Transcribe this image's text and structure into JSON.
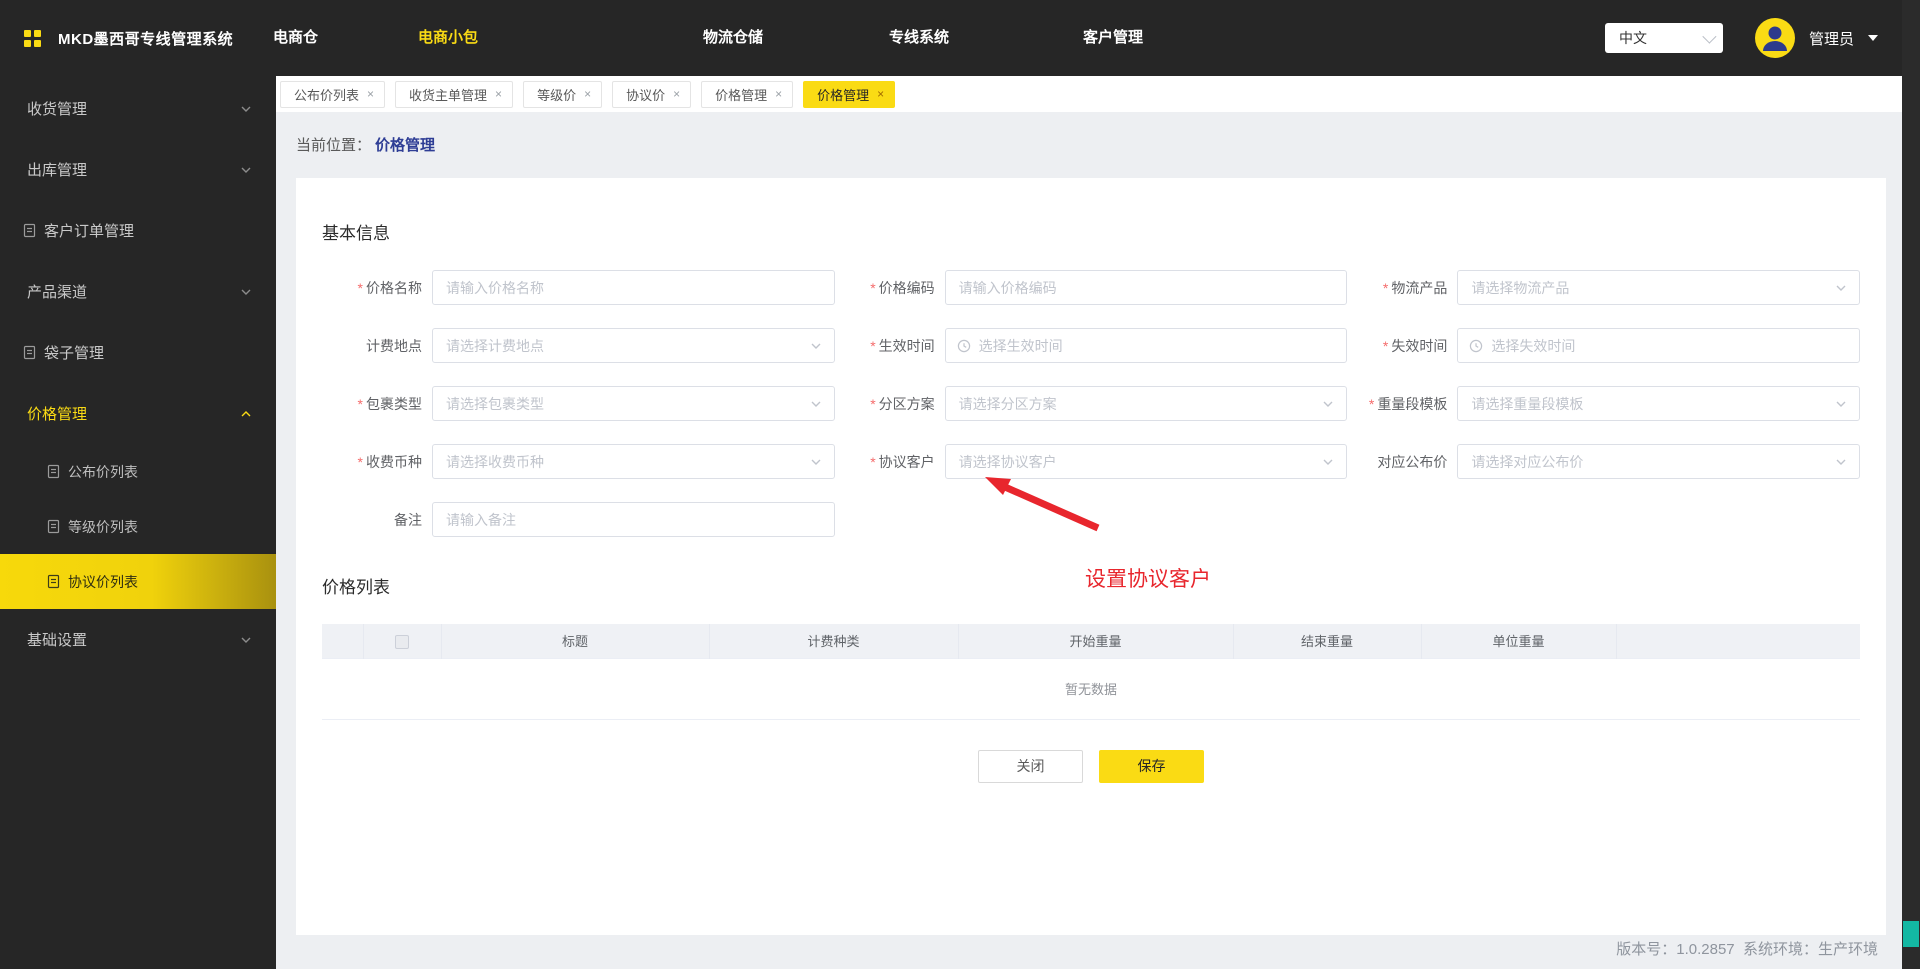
{
  "header": {
    "title": "MKD墨西哥专线管理系统",
    "nav": [
      {
        "label": "电商仓",
        "name": "nav-item-ecommerce-warehouse",
        "active": false
      },
      {
        "label": "电商小包",
        "name": "nav-item-ecommerce-parcel",
        "active": true
      },
      {
        "label": "物流仓储",
        "name": "nav-item-logistics-storage",
        "active": false
      },
      {
        "label": "专线系统",
        "name": "nav-item-dedicated-line",
        "active": false
      },
      {
        "label": "客户管理",
        "name": "nav-item-customer-management",
        "active": false
      }
    ],
    "language": "中文",
    "user": "管理员"
  },
  "sidebar": {
    "items": [
      {
        "label": "收货管理",
        "name": "sidebar-item-receiving",
        "type": "group",
        "chevron": "down"
      },
      {
        "label": "出库管理",
        "name": "sidebar-item-outbound",
        "type": "group",
        "chevron": "down"
      },
      {
        "label": "客户订单管理",
        "name": "sidebar-item-customer-orders",
        "type": "doc"
      },
      {
        "label": "产品渠道",
        "name": "sidebar-item-product-channel",
        "type": "group",
        "chevron": "down"
      },
      {
        "label": "袋子管理",
        "name": "sidebar-item-bag-management",
        "type": "doc"
      },
      {
        "label": "价格管理",
        "name": "sidebar-item-price-management",
        "type": "group",
        "chevron": "up",
        "open": true
      },
      {
        "label": "公布价列表",
        "name": "sidebar-item-published-price-list",
        "type": "sub"
      },
      {
        "label": "等级价列表",
        "name": "sidebar-item-level-price-list",
        "type": "sub"
      },
      {
        "label": "协议价列表",
        "name": "sidebar-item-agreement-price-list",
        "type": "sub",
        "active": true
      },
      {
        "label": "基础设置",
        "name": "sidebar-item-basic-settings",
        "type": "group",
        "chevron": "down"
      }
    ]
  },
  "tabs": [
    {
      "label": "公布价列表",
      "name": "tab-published-price-list",
      "active": false
    },
    {
      "label": "收货主单管理",
      "name": "tab-receiving-master-order",
      "active": false
    },
    {
      "label": "等级价",
      "name": "tab-level-price",
      "active": false
    },
    {
      "label": "协议价",
      "name": "tab-agreement-price",
      "active": false
    },
    {
      "label": "价格管理",
      "name": "tab-price-management-1",
      "active": false
    },
    {
      "label": "价格管理",
      "name": "tab-price-management-2",
      "active": true
    }
  ],
  "breadcrumb": {
    "prefix": "当前位置：",
    "current": "价格管理"
  },
  "form": {
    "section_title": "基本信息",
    "fields": [
      {
        "label": "价格名称",
        "required": true,
        "kind": "input",
        "placeholder": "请输入价格名称",
        "name": "price-name-input"
      },
      {
        "label": "价格编码",
        "required": true,
        "kind": "input",
        "placeholder": "请输入价格编码",
        "name": "price-code-input"
      },
      {
        "label": "物流产品",
        "required": true,
        "kind": "select",
        "placeholder": "请选择物流产品",
        "name": "logistics-product-select"
      },
      {
        "label": "计费地点",
        "required": false,
        "kind": "select",
        "placeholder": "请选择计费地点",
        "name": "billing-location-select"
      },
      {
        "label": "生效时间",
        "required": true,
        "kind": "time",
        "placeholder": "选择生效时间",
        "name": "effective-time-picker"
      },
      {
        "label": "失效时间",
        "required": true,
        "kind": "time",
        "placeholder": "选择失效时间",
        "name": "expiry-time-picker"
      },
      {
        "label": "包裹类型",
        "required": true,
        "kind": "select",
        "placeholder": "请选择包裹类型",
        "name": "parcel-type-select"
      },
      {
        "label": "分区方案",
        "required": true,
        "kind": "select",
        "placeholder": "请选择分区方案",
        "name": "zone-plan-select"
      },
      {
        "label": "重量段模板",
        "required": true,
        "kind": "select",
        "placeholder": "请选择重量段模板",
        "name": "weight-segment-template-select"
      },
      {
        "label": "收费币种",
        "required": true,
        "kind": "select",
        "placeholder": "请选择收费币种",
        "name": "charge-currency-select"
      },
      {
        "label": "协议客户",
        "required": true,
        "kind": "select",
        "placeholder": "请选择协议客户",
        "name": "agreement-customer-select"
      },
      {
        "label": "对应公布价",
        "required": false,
        "kind": "select",
        "placeholder": "请选择对应公布价",
        "name": "published-price-select"
      },
      {
        "label": "备注",
        "required": false,
        "kind": "input",
        "placeholder": "请输入备注",
        "name": "remark-input"
      }
    ]
  },
  "price_list": {
    "title": "价格列表",
    "columns": [
      "标题",
      "计费种类",
      "开始重量",
      "结束重量",
      "单位重量"
    ],
    "empty_text": "暂无数据"
  },
  "actions": {
    "close_label": "关闭",
    "save_label": "保存"
  },
  "annotation": {
    "text": "设置协议客户"
  },
  "footer": {
    "text": "版本号：1.0.2857  系统环境：生产环境"
  },
  "icons": {
    "close_glyph": "×"
  },
  "colors": {
    "accent": "#fadb14",
    "header_bg": "#262626",
    "annotation_red": "#e8262d",
    "breadcrumb_link": "#2e3d95",
    "strip_indicator": "#13b8a3"
  }
}
